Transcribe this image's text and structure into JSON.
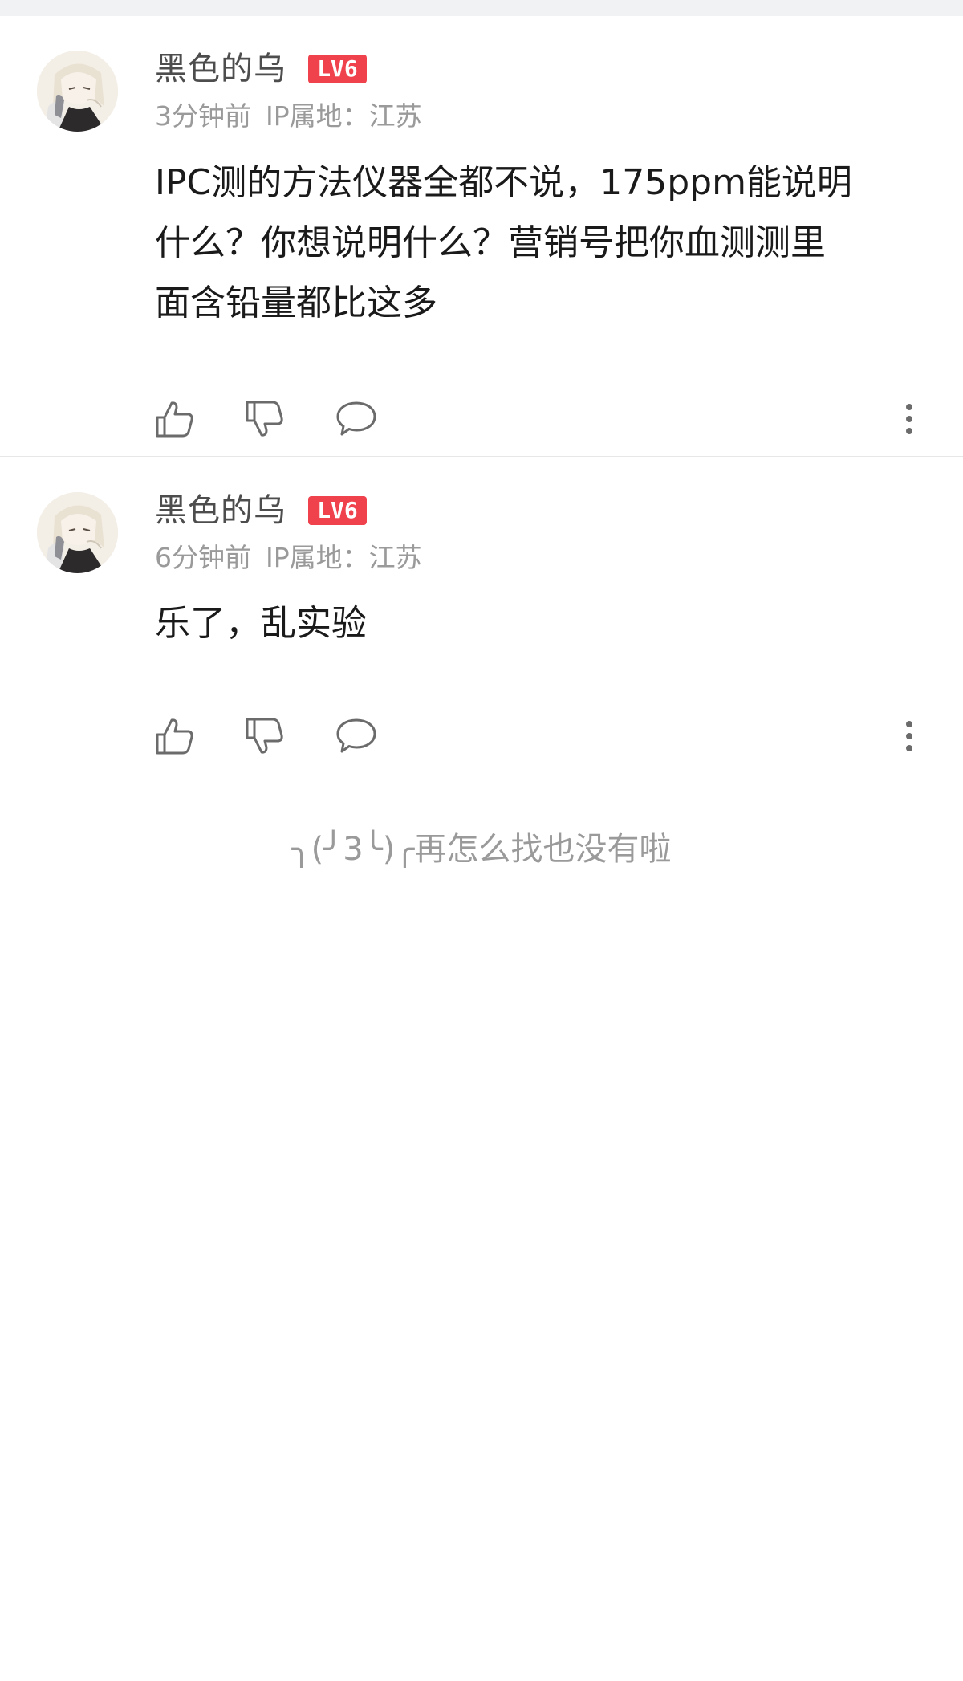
{
  "comments": [
    {
      "username": "黑色的乌",
      "level": "LV6",
      "time": "3分钟前",
      "ip_location": "IP属地：江苏",
      "content_lines": [
        "IPC测的方法仪器全都不说，175ppm能说明",
        "什么？你想说明什么？营销号把你血测测里",
        "面含铅量都比这多"
      ],
      "icons": {
        "like": "thumbs-up-icon",
        "dislike": "thumbs-down-icon",
        "reply": "speech-bubble-icon",
        "more": "vertical-dots-icon"
      }
    },
    {
      "username": "黑色的乌",
      "level": "LV6",
      "time": "6分钟前",
      "ip_location": "IP属地：江苏",
      "content_lines": [
        "乐了，乱实验"
      ],
      "icons": {
        "like": "thumbs-up-icon",
        "dislike": "thumbs-down-icon",
        "reply": "speech-bubble-icon",
        "more": "vertical-dots-icon"
      }
    }
  ],
  "end_of_list_text": "╮(╯3╰)╭再怎么找也没有啦",
  "colors": {
    "level_badge": "#f0424d",
    "username": "#4d4d4d",
    "meta": "#9a9a9a",
    "content": "#1a1a1a",
    "divider": "#e7e7e7",
    "top_strip": "#f1f2f3"
  }
}
